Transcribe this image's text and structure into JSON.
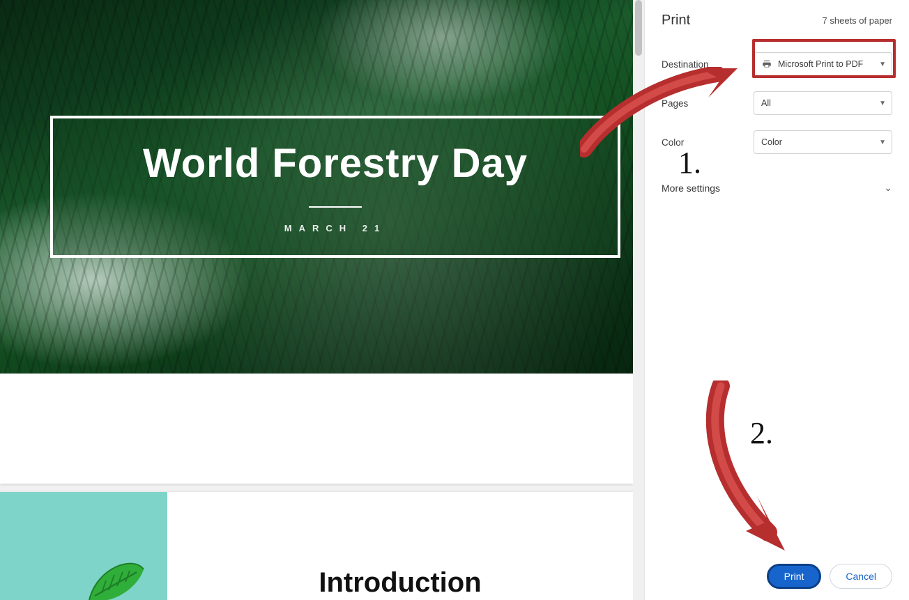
{
  "preview": {
    "hero_title": "World Forestry Day",
    "hero_date": "MARCH 21",
    "intro_title": "Introduction"
  },
  "panel": {
    "title": "Print",
    "sheets": "7 sheets of paper",
    "destination_label": "Destination",
    "destination_value": "Microsoft Print to PDF",
    "pages_label": "Pages",
    "pages_value": "All",
    "color_label": "Color",
    "color_value": "Color",
    "more_label": "More settings",
    "print_label": "Print",
    "cancel_label": "Cancel"
  },
  "annotations": {
    "step1": "1.",
    "step2": "2."
  }
}
